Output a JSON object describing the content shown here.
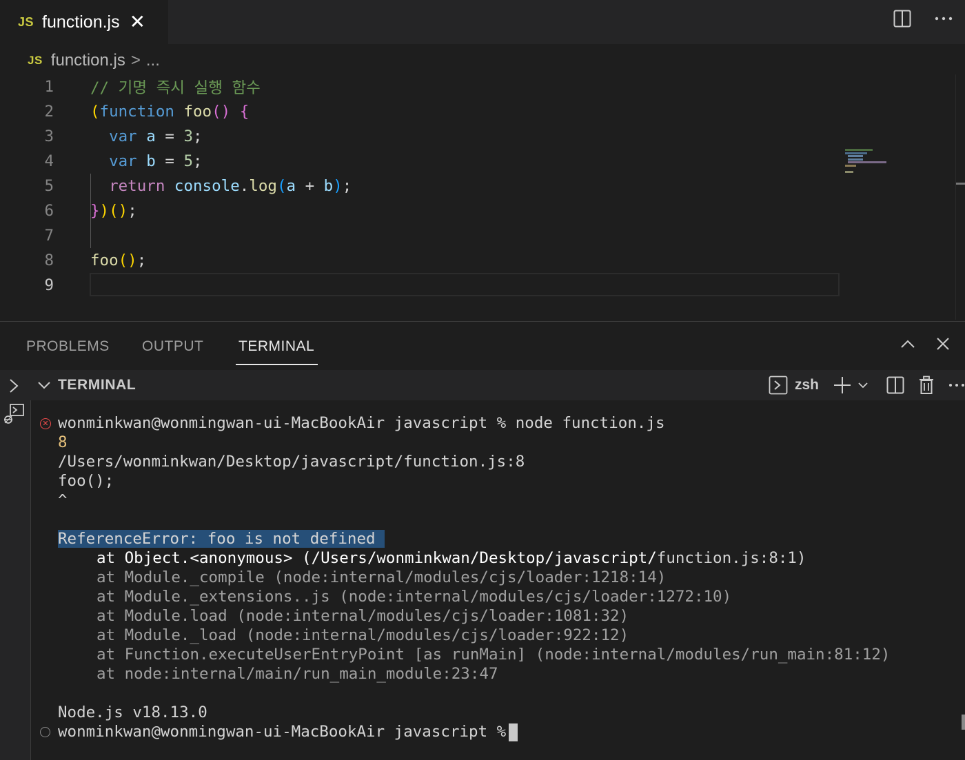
{
  "tab": {
    "badge": "JS",
    "title": "function.js"
  },
  "breadcrumb": {
    "badge": "JS",
    "file": "function.js",
    "sep": ">",
    "more": "..."
  },
  "editor": {
    "line_numbers": [
      "1",
      "2",
      "3",
      "4",
      "5",
      "6",
      "7",
      "8",
      "9"
    ],
    "comment": "// 기명 즉시 실행 함수",
    "kw_function": "function",
    "fn_foo": "foo",
    "kw_var": "var",
    "var_a": "a",
    "var_b": "b",
    "num_3": "3",
    "num_5": "5",
    "kw_return": "return",
    "console": "console",
    "log": "log"
  },
  "panel": {
    "tabs": [
      "PROBLEMS",
      "OUTPUT",
      "TERMINAL"
    ],
    "terminal_header": "TERMINAL",
    "shell": "zsh"
  },
  "terminal": {
    "lines": [
      "wonminkwan@wonmingwan-ui-MacBookAir javascript % node function.js",
      "8",
      "/Users/wonminkwan/Desktop/javascript/function.js:8",
      "foo();",
      "^",
      "",
      "ReferenceError: foo is not defined",
      "at Object.<anonymous> (/Users/wonminkwan/Desktop/javascript/",
      "function.js:8:1)",
      "at Module._compile (node:internal/modules/cjs/loader:1218:14)",
      "at Module._extensions..js (node:internal/modules/cjs/loader:1272:10)",
      "at Module.load (node:internal/modules/cjs/loader:1081:32)",
      "at Module._load (node:internal/modules/cjs/loader:922:12)",
      "at Function.executeUserEntryPoint [as runMain] (node:internal/modules/run_main:81:12)",
      "at node:internal/main/run_main_module:23:47",
      "Node.js v18.13.0",
      "wonminkwan@wonmingwan-ui-MacBookAir javascript %"
    ]
  },
  "colors": {
    "error": "#f14c4c",
    "selection": "#264f78",
    "accent": "#e7e7e7"
  }
}
